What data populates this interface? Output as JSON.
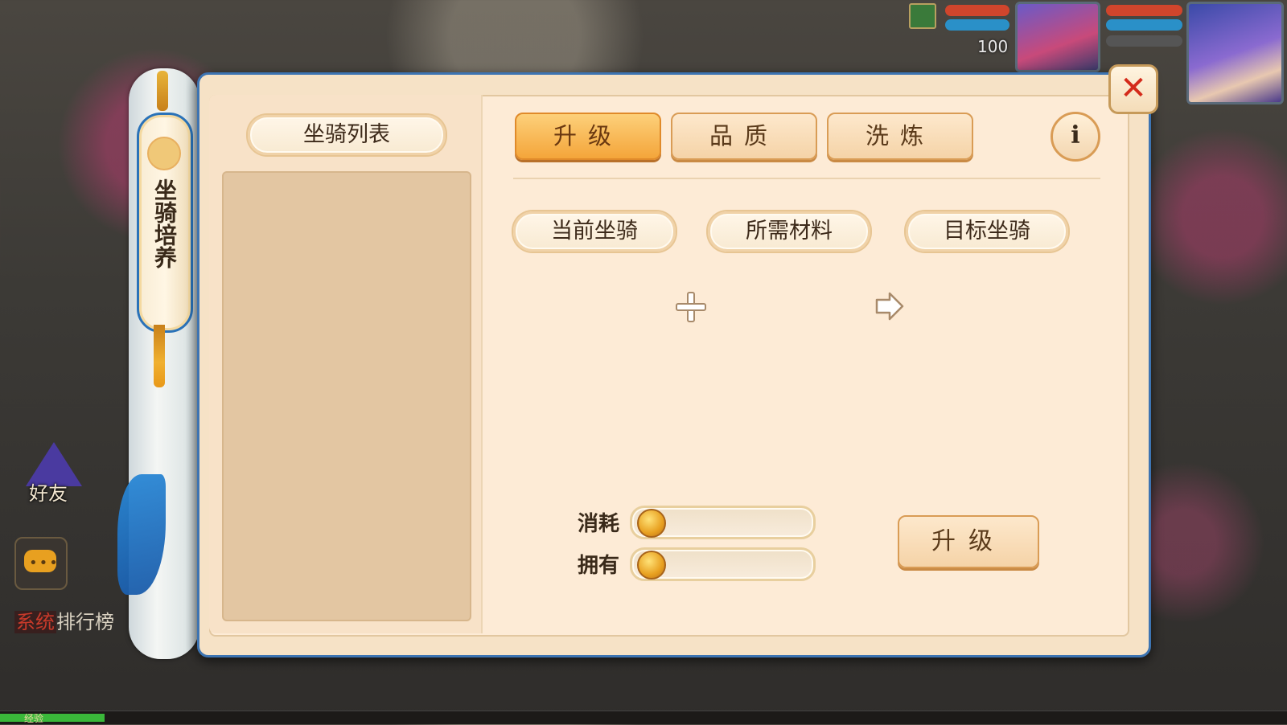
{
  "hud": {
    "level": "100"
  },
  "sidebar": {
    "friend_label": "好友",
    "system_tag": "系统",
    "ranking_label": "排行榜",
    "exp_label": "经验"
  },
  "scroll_tag": {
    "title": "坐骑培养"
  },
  "panel": {
    "list_title": "坐骑列表",
    "tabs": [
      {
        "label": "升级",
        "active": true
      },
      {
        "label": "品质",
        "active": false
      },
      {
        "label": "洗炼",
        "active": false
      }
    ],
    "info_label": "i",
    "sections": {
      "current": "当前坐骑",
      "material": "所需材料",
      "target": "目标坐骑"
    },
    "cost": {
      "consume_label": "消耗",
      "own_label": "拥有",
      "consume_value": "",
      "own_value": ""
    },
    "upgrade_button": "升级",
    "close_label": "✕"
  },
  "colors": {
    "panel_border": "#3d74b2",
    "active_tab": "#f4a53a",
    "close_x": "#d42a1a"
  },
  "icons": [
    "plus-icon",
    "arrow-right-icon",
    "coin-icon",
    "info-icon",
    "close-icon",
    "chat-icon"
  ]
}
